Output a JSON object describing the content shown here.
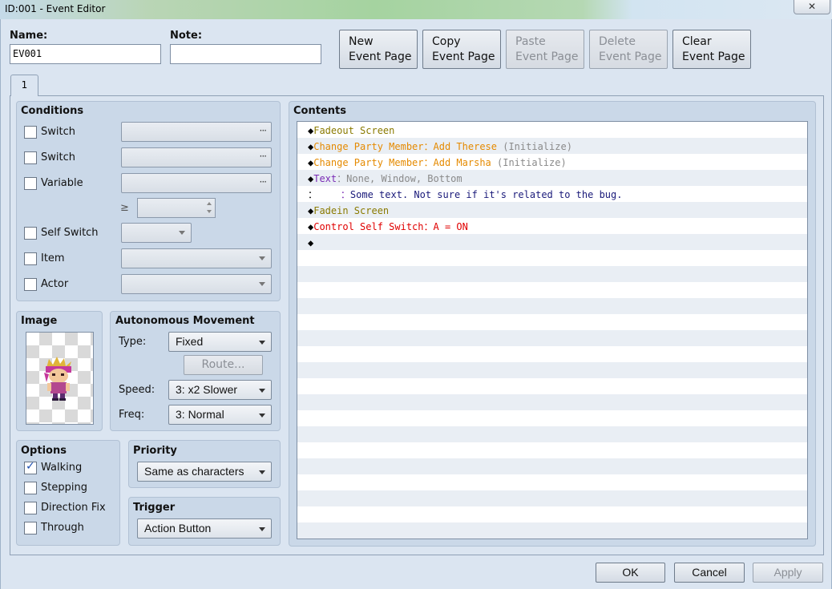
{
  "window": {
    "title": "ID:001 - Event Editor",
    "close_glyph": "✕"
  },
  "header": {
    "name_label": "Name:",
    "name_value": "EV001",
    "note_label": "Note:",
    "note_value": "",
    "buttons": [
      {
        "line1": "New",
        "line2": "Event Page",
        "enabled": true
      },
      {
        "line1": "Copy",
        "line2": "Event Page",
        "enabled": true
      },
      {
        "line1": "Paste",
        "line2": "Event Page",
        "enabled": false
      },
      {
        "line1": "Delete",
        "line2": "Event Page",
        "enabled": false
      },
      {
        "line1": "Clear",
        "line2": "Event Page",
        "enabled": true
      }
    ]
  },
  "tabs": [
    {
      "label": "1"
    }
  ],
  "conditions": {
    "title": "Conditions",
    "switch1": "Switch",
    "switch2": "Switch",
    "variable": "Variable",
    "gte": "≥",
    "self_switch": "Self Switch",
    "item": "Item",
    "actor": "Actor"
  },
  "image": {
    "title": "Image",
    "sprite_icon": "character-sprite-icon"
  },
  "movement": {
    "title": "Autonomous Movement",
    "type_label": "Type:",
    "type_value": "Fixed",
    "route_label": "Route...",
    "speed_label": "Speed:",
    "speed_value": "3: x2 Slower",
    "freq_label": "Freq:",
    "freq_value": "3: Normal"
  },
  "options": {
    "title": "Options",
    "walking": "Walking",
    "walking_checked": true,
    "stepping": "Stepping",
    "direction_fix": "Direction Fix",
    "through": "Through"
  },
  "priority": {
    "title": "Priority",
    "value": "Same as characters"
  },
  "trigger": {
    "title": "Trigger",
    "value": "Action Button"
  },
  "contents": {
    "title": "Contents",
    "lines": [
      {
        "prefix": "◆",
        "cmd": "Fadeout Screen",
        "arg": "",
        "note": ""
      },
      {
        "prefix": "◆",
        "cmd": "Change Party Member：",
        "arg": "Add Therese",
        "note": " (Initialize)"
      },
      {
        "prefix": "◆",
        "cmd": "Change Party Member：",
        "arg": "Add Marsha",
        "note": " (Initialize)"
      },
      {
        "prefix": "◆",
        "cmd": "Text",
        "arg": "：None, Window, Bottom",
        "note": ""
      },
      {
        "prefix": "：",
        "cmd": "    ：",
        "arg": "Some text. Not sure if it's related to the bug.",
        "note": ""
      },
      {
        "prefix": "◆",
        "cmd": "Fadein Screen",
        "arg": "",
        "note": ""
      },
      {
        "prefix": "◆",
        "cmd": "Control Self Switch：",
        "arg": "A = ON",
        "note": ""
      },
      {
        "prefix": "◆",
        "cmd": "",
        "arg": "",
        "note": ""
      }
    ]
  },
  "footer": {
    "ok": "OK",
    "cancel": "Cancel",
    "apply": "Apply"
  }
}
